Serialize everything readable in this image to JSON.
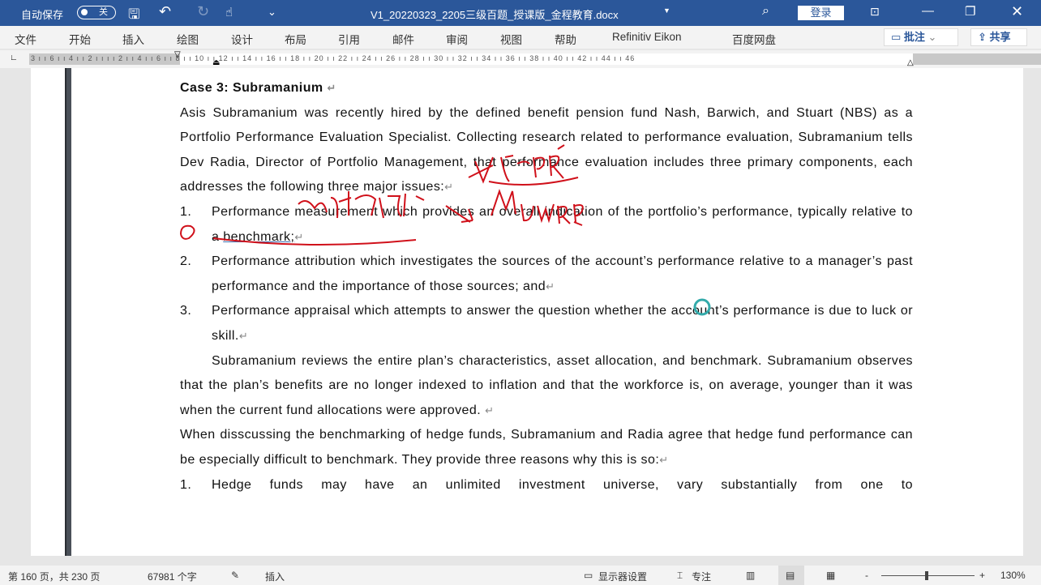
{
  "titlebar": {
    "autosave_label": "自动保存",
    "autosave_state": "关",
    "doc_title": "V1_20220323_2205三级百题_授课版_金程教育.docx",
    "login": "登录"
  },
  "ribbon": {
    "tabs": [
      "文件",
      "开始",
      "插入",
      "绘图",
      "设计",
      "布局",
      "引用",
      "邮件",
      "审阅",
      "视图",
      "帮助",
      "Refinitiv Eikon",
      "百度网盘"
    ],
    "comments": "批注",
    "share": "共享"
  },
  "ruler": {
    "ticks": "3 ı ı 6 ı ı 4 ı ı 2 ı ı ı ı 2 ı ı 4 ı ı 6 ı ı 8 ı ı 10 ı ı 12 ı ı 14 ı ı 16 ı ı 18 ı ı 20 ı ı 22 ı ı 24 ı ı 26 ı ı 28 ı ı 30 ı ı 32 ı ı 34 ı ı 36 ı ı 38 ı ı 40 ı ı 42 ı ı 44 ı ı 46"
  },
  "document": {
    "heading": "Case 3: Subramanium",
    "para1": "Asis Subramanium was recently hired by the defined benefit pension fund Nash, Barwich, and Stuart (NBS) as a Portfolio Performance Evaluation Specialist. Collecting research related to performance evaluation, Subramanium tells Dev Radia, Director of Portfolio Management, that performance evaluation includes three primary components, each addresses the following three major issues:",
    "list1": [
      {
        "num": "1.",
        "text": "Performance measurement which provides an overall indication of the portfolio’s performance, typically relative to a ",
        "link": "benchmark;"
      },
      {
        "num": "2.",
        "text": "Performance attribution which investigates the sources of the account’s performance relative to a manager’s past performance and the importance of those sources; and"
      },
      {
        "num": "3.",
        "text": "Performance appraisal which attempts to answer the question whether the account’s performance is due to luck or skill."
      }
    ],
    "para2": "Subramanium reviews the entire plan’s characteristics, asset allocation, and benchmark. Subramanium observes that the plan’s benefits are no longer indexed to inflation and that the workforce is, on average, younger than it was when the current fund allocations were approved.",
    "para3": "When disscussing the benchmarking of hedge funds, Subramanium and Radia agree that hedge fund performance can be especially difficult to benchmark. They provide three reasons why this is so:",
    "list2": [
      {
        "num": "1.",
        "text": "Hedge funds may have an unlimited investment universe, vary substantially from one to"
      }
    ],
    "para_mark": "↵"
  },
  "status": {
    "page": "第 160 页，共 230 页",
    "words": "67981 个字",
    "mode": "插入",
    "display_settings": "显示器设置",
    "focus": "专注",
    "zoom_minus": "-",
    "zoom_plus": "+",
    "zoom": "130%"
  },
  "colors": {
    "titlebar": "#2b579a",
    "ink": "#d0101a"
  }
}
